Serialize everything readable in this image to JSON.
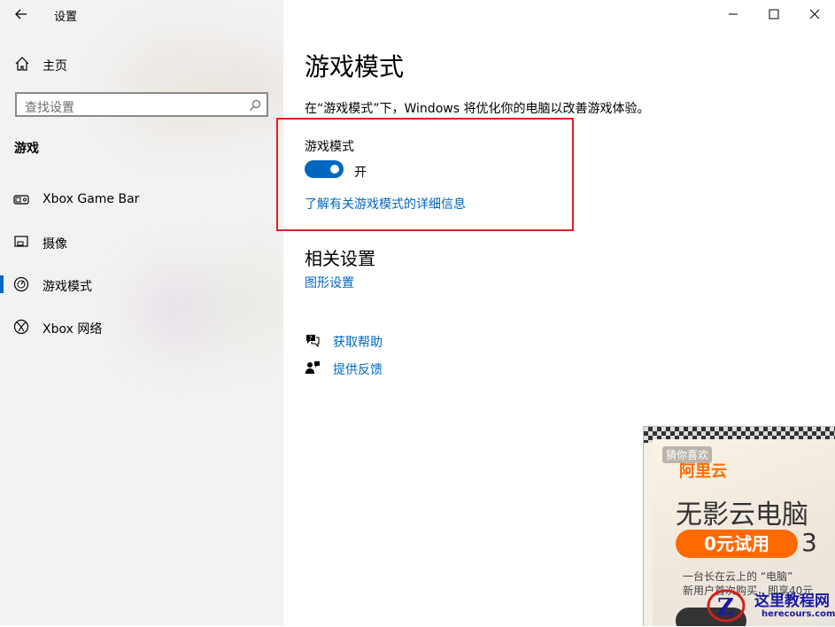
{
  "window": {
    "title": "设置"
  },
  "sidebar": {
    "home_label": "主页",
    "search_placeholder": "查找设置",
    "section": "游戏",
    "items": [
      {
        "label": "Xbox Game Bar",
        "icon": "game-bar-icon",
        "selected": false
      },
      {
        "label": "摄像",
        "icon": "capture-icon",
        "selected": false
      },
      {
        "label": "游戏模式",
        "icon": "game-mode-icon",
        "selected": true
      },
      {
        "label": "Xbox 网络",
        "icon": "xbox-icon",
        "selected": false
      }
    ]
  },
  "main": {
    "title": "游戏模式",
    "description": "在“游戏模式”下，Windows 将优化你的电脑以改善游戏体验。",
    "setting_label": "游戏模式",
    "toggle_state": "开",
    "toggle_on": true,
    "learn_more": "了解有关游戏模式的详细信息",
    "related_title": "相关设置",
    "related_link": "图形设置",
    "help_link": "获取帮助",
    "feedback_link": "提供反馈"
  },
  "ad": {
    "guess_label": "猜你喜欢",
    "brand": "阿里云",
    "headline": "无影云电脑",
    "cta": "0元试用",
    "cta_suffix": "3",
    "line1": "一台长在云上的 “电脑”",
    "line2": "新用户首次购买，即享40元"
  },
  "watermark": {
    "title": "这里教程网",
    "url": "herecours.com"
  },
  "colors": {
    "accent": "#0067c0",
    "highlight_border": "#e02020",
    "sidebar_bg": "#f2f2f2",
    "ad_orange": "#ff6a00"
  }
}
